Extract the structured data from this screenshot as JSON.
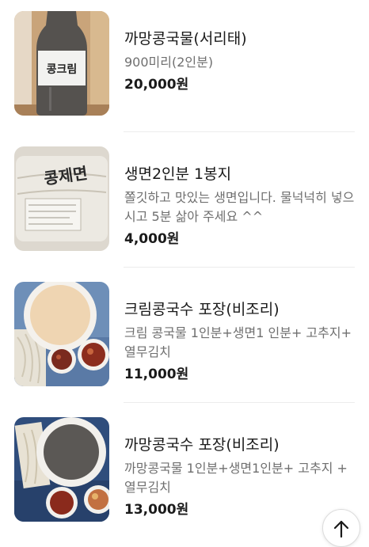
{
  "menu_items": [
    {
      "name": "까망콩국물(서리태)",
      "description": "900미리(2인분)",
      "price": "20,000원",
      "image_icon": "black-bean-milk-bottle-image",
      "label_text": "콩크림"
    },
    {
      "name": "생면2인분 1봉지",
      "description": "쫄깃하고 맛있는 생면입니다. 물넉넉히 넣으시고 5분 삶아 주세요 ^^",
      "price": "4,000원",
      "image_icon": "fresh-noodle-pack-image",
      "label_text": "콩제면"
    },
    {
      "name": "크림콩국수 포장(비조리)",
      "description": "크림 콩국물 1인분+생면1 인분+ 고추지+ 열무김치",
      "price": "11,000원",
      "image_icon": "cream-bean-soup-package-image"
    },
    {
      "name": "까망콩국수 포장(비조리)",
      "description": "까망콩국물 1인분+생면1인분+ 고추지 + 열무김치",
      "price": "13,000원",
      "image_icon": "black-bean-soup-package-image"
    }
  ],
  "scroll_top_button": {
    "icon": "arrow-up-icon"
  },
  "colors": {
    "price": "#1a1a1a",
    "description": "#6f6f6f",
    "divider": "#ececec"
  }
}
